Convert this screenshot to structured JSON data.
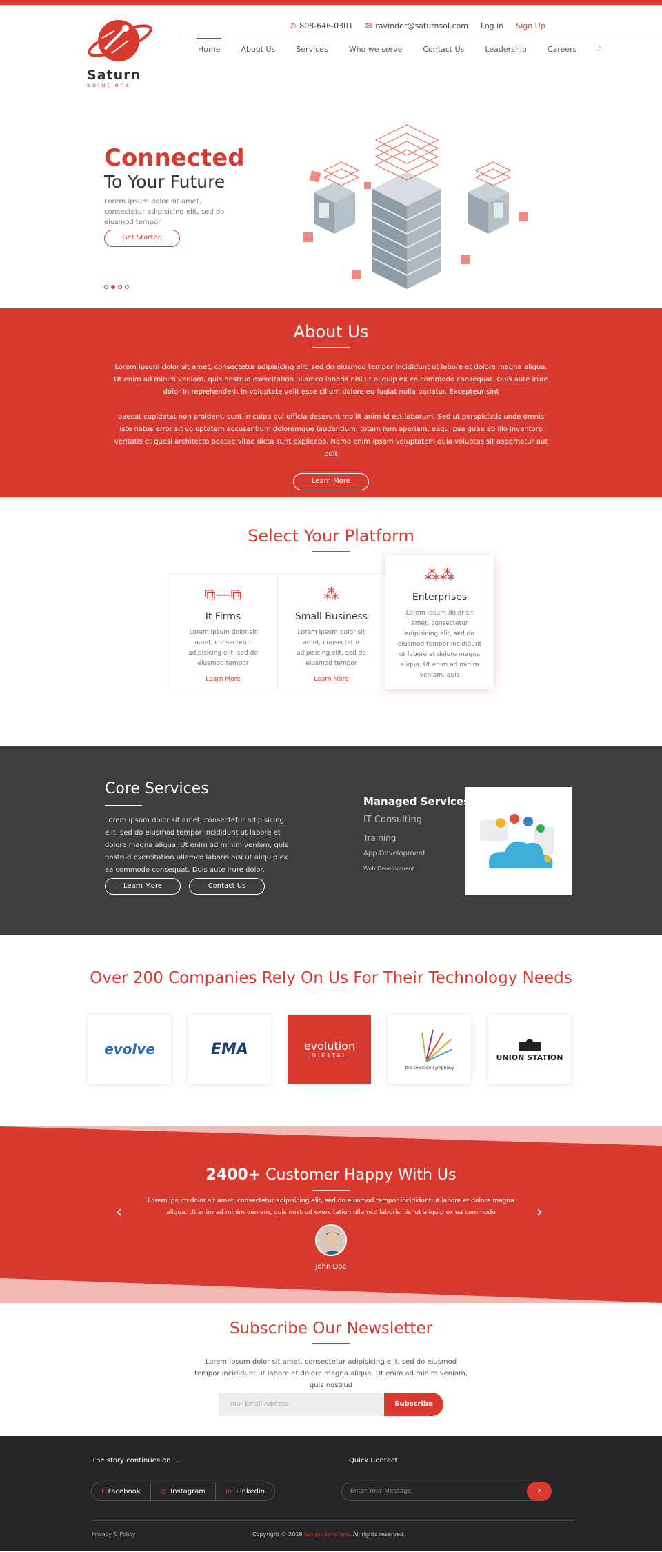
{
  "header": {
    "logo_word": "Saturn",
    "logo_sub": "Solutions",
    "phone": "808-646-0301",
    "email": "ravinder@saturnsol.com",
    "login": "Log in",
    "signup": "Sign Up",
    "nav": [
      "Home",
      "About Us",
      "Services",
      "Who we serve",
      "Contact Us",
      "Leadership",
      "Careers"
    ]
  },
  "hero": {
    "title": "Connected",
    "subtitle": "To Your Future",
    "text": "Lorem ipsum dolor sit amet, consectetur adipisicing elit, sed do eiusmod tempor",
    "button": "Get Started"
  },
  "about": {
    "title": "About Us",
    "para1": "Lorem ipsum dolor sit amet, consectetur adipisicing elit, sed do eiusmod tempor incididunt ut labore et dolore magna aliqua. Ut enim ad minim veniam, quis nostrud exercitation ullamco laboris nisi ut aliquip ex ea commodo consequat. Duis aute irure dolor in reprehenderit in voluptate velit esse cillum dolore eu fugiat nulla pariatur. Excepteur sint",
    "para2": "oaecat cupidatat non proident, sunt in culpa qui officia deserunt mollit anim id est laborum. Sed ut perspiciatis unde omnis iste natus error sit voluptatem accusantium doloremque laudantium, totam rem aperiam, eaqu ipsa quae ab illo inventore veritatis et quasi architecto beatae vitae dicta sunt explicabo. Nemo enim ipsam voluptatem quia voluptas sit aspernatur aut odit",
    "button": "Learn More"
  },
  "platform": {
    "title": "Select Your Platform",
    "cards": [
      {
        "title": "It Firms",
        "text": "Lorem ipsum dolor sit amet, consectetur adipisicing elit, sed do eiusmod tempor",
        "link": "Learn More"
      },
      {
        "title": "Small Business",
        "text": "Lorem ipsum dolor sit amet, consectetur adipisicing elit, sed do eiusmod tempor",
        "link": "Learn More"
      },
      {
        "title": "Enterprises",
        "text": "Lorem ipsum dolor sit amet, consectetur adipisicing elit, sed do eiusmod tempor incididunt ut labore et dolore magna aliqua. Ut enim ad minim veniam, quis"
      }
    ]
  },
  "core": {
    "title": "Core Services",
    "text": "Lorem ipsum dolor sit amet, consectetur adipisicing elit, sed do eiusmod tempor incididunt ut labore et dolore magna aliqua. Ut enim ad minim veniam, quis nostrud exercitation ullamco laboris nisi ut aliquip ex ea commodo consequat. Duis aute irure dolor.",
    "btn_learn": "Learn More",
    "btn_contact": "Contact Us",
    "services": [
      "Managed Services",
      "IT Consulting",
      "Training",
      "App Development",
      "Web Development"
    ]
  },
  "clients": {
    "title": "Over 200 Companies Rely On Us For Their Technology Needs",
    "logos": [
      "evolve",
      "EMA",
      "evolution",
      "the colorado symphony",
      "UNION STATION"
    ],
    "logo_sub": "DIGITAL"
  },
  "testimonial": {
    "count": "2400+",
    "title": "Customer Happy With Us",
    "text": "Lorem ipsum dolor sit amet, consectetur adipisicing elit, sed do eiusmod tempor incididunt ut labore et dolore magna aliqua. Ut enim ad minim veniam, quis nostrud exercitation ullamco laboris nisi ut aliquip ex ea commodo",
    "name": "John Doe"
  },
  "newsletter": {
    "title": "Subscribe Our Newsletter",
    "text": "Lorem ipsum dolor sit amet, consectetur adipisicing elit, sed do eiusmod tempor incididunt ut labore et dolore magna aliqua. Ut enim ad minim veniam, quis nostrud",
    "placeholder": "Your Email Address",
    "button": "Subscribe"
  },
  "footer": {
    "story": "The story continues on ...",
    "quick": "Quick Contact",
    "social": [
      "Facebook",
      "Instagram",
      "Linkedin"
    ],
    "msg_placeholder": "Enter Your Message",
    "privacy": "Privacy & Policy",
    "copy_pre": "Copyright © 2018",
    "copy_brand": "Saturn Solutions",
    "copy_post": ". All rights reserved."
  },
  "colors": {
    "accent": "#d93a30",
    "dark": "#3e3e40",
    "footer": "#262626"
  }
}
